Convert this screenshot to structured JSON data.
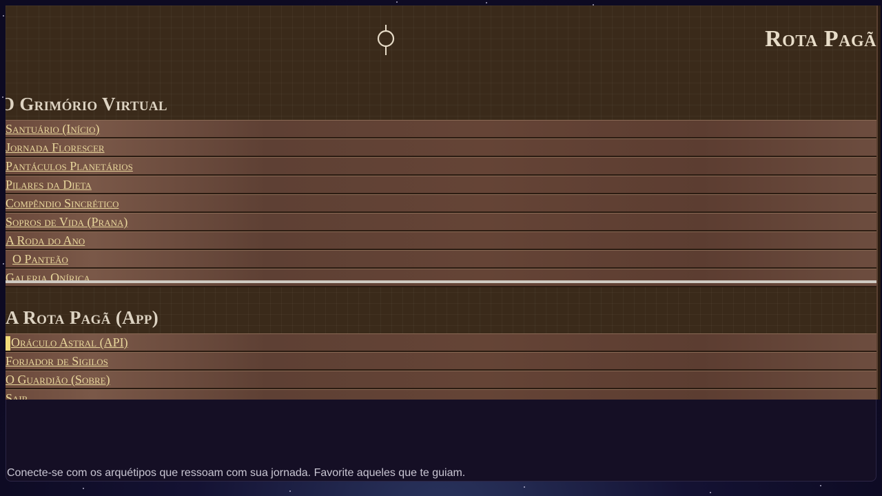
{
  "header": {
    "brand_title": "Rota Pagã",
    "logo_icon": "sigil-icon"
  },
  "grimorio": {
    "title": "O Grimório Virtual",
    "items": [
      {
        "label": "Santuário (Início)"
      },
      {
        "label": "Jornada Florescer"
      },
      {
        "label": "Pantáculos Planetários"
      },
      {
        "label": "Pilares da Dieta"
      },
      {
        "label": "Compêndio Sincrético"
      },
      {
        "label": "Sopros de Vida (Prana)"
      },
      {
        "label": "A Roda do Ano"
      },
      {
        "label": "O Panteão"
      },
      {
        "label": "Galeria Onírica"
      }
    ]
  },
  "app": {
    "title": "A Rota Pagã (App)",
    "items": [
      {
        "label": "Oráculo Astral (API)"
      },
      {
        "label": "Forjador de Sigilos"
      },
      {
        "label": "O Guardião (Sobre)"
      },
      {
        "label": "Sair"
      }
    ]
  },
  "main": {
    "intro_text": "Conecte-se com os arquétipos que ressoam com sua jornada. Favorite aqueles que te guiam."
  },
  "colors": {
    "panel_bg": "#3a2a1a",
    "menu_link": "#e9d79c",
    "active_marker": "#f2db7a",
    "page_bg": "#0d0a22"
  }
}
